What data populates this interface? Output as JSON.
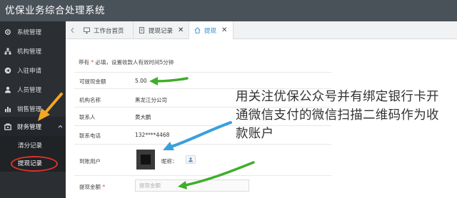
{
  "app": {
    "title": "优保业务综合处理系统"
  },
  "sidebar": {
    "items": [
      {
        "label": "系统管理",
        "icon": "gear-icon"
      },
      {
        "label": "机构管理",
        "icon": "org-chart-icon"
      },
      {
        "label": "入驻申请",
        "icon": "sign-in-icon"
      },
      {
        "label": "人员管理",
        "icon": "user-icon"
      },
      {
        "label": "销售管理",
        "icon": "bar-chart-icon"
      },
      {
        "label": "财务管理",
        "icon": "finance-icon"
      }
    ],
    "sub_items": [
      {
        "label": "清分记录"
      },
      {
        "label": "提现记录"
      }
    ]
  },
  "tabs": [
    {
      "label": "工作台首页",
      "icon": "monitor-icon"
    },
    {
      "label": "提现记录",
      "icon": "document-icon",
      "close": "✕"
    },
    {
      "label": "提现",
      "icon": "home-icon",
      "close": "✕"
    }
  ],
  "form": {
    "hint_prefix": "带有",
    "hint_star": "*",
    "hint_suffix": "必填，设置收款人有效时间5分钟",
    "rows": [
      {
        "label": "可提现金额",
        "value": "5.00"
      },
      {
        "label": "机构名称",
        "value": "黑龙江分公司"
      },
      {
        "label": "联系人",
        "value": "黄大鹏"
      },
      {
        "label": "联系电话",
        "value": "132****4468"
      },
      {
        "label": "到账用户",
        "value": ""
      }
    ],
    "nickname_label": "昵称：",
    "amount_label": "提现金额",
    "amount_required": "*",
    "amount_placeholder": "提现金额"
  },
  "annotation": {
    "text": "用关注优保公众号并有绑定银行卡开通微信支付的微信扫描二维码作为收款账户"
  },
  "colors": {
    "topbar": "#4a5259",
    "sidebar": "#2b2f33",
    "accent_tab": "#2f8fcf",
    "required": "#e6473b",
    "green_arrow": "#3fae2a",
    "orange_arrow": "#f5a623",
    "blue_arrow": "#3aa0dc",
    "red_circle": "#e2302a"
  }
}
